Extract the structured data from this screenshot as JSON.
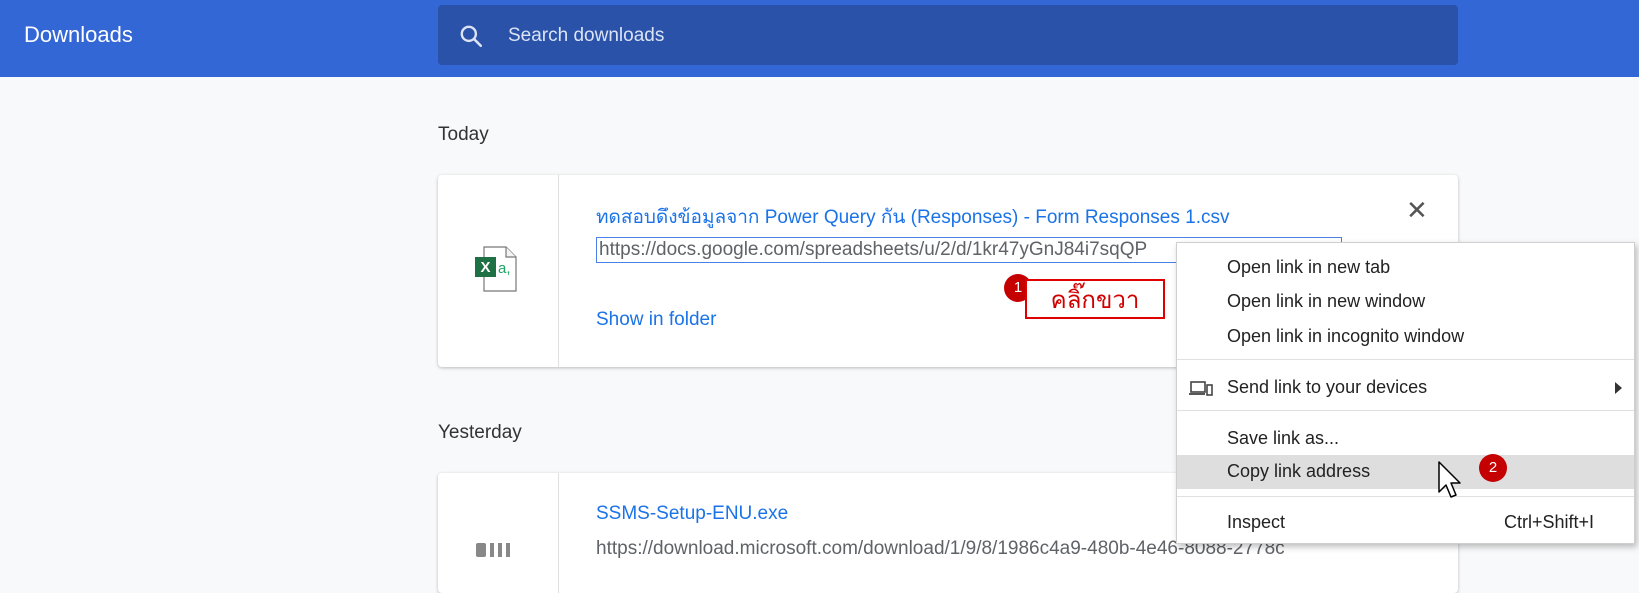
{
  "header": {
    "title": "Downloads",
    "search_placeholder": "Search downloads"
  },
  "sections": {
    "today": "Today",
    "yesterday": "Yesterday"
  },
  "downloads": [
    {
      "name": "ทดสอบดึงข้อมูลจาก Power Query กัน (Responses) - Form Responses 1.csv",
      "url": "https://docs.google.com/spreadsheets/u/2/d/1kr47yGnJ84i7sqQP",
      "action": "Show in folder",
      "icon": "excel-csv-icon"
    },
    {
      "name": "SSMS-Setup-ENU.exe",
      "url": "https://download.microsoft.com/download/1/9/8/1986c4a9-480b-4e46-8088-2778c",
      "icon": "installer-icon"
    }
  ],
  "annotations": {
    "step1_number": "1",
    "step1_text": "คลิ๊กขวา",
    "step2_number": "2",
    "color": "#c40000"
  },
  "context_menu": {
    "items": {
      "open_new_tab": "Open link in new tab",
      "open_new_window": "Open link in new window",
      "open_incognito": "Open link in incognito window",
      "send_to_devices": "Send link to your devices",
      "save_link_as": "Save link as...",
      "copy_link_address": "Copy link address",
      "inspect": "Inspect",
      "inspect_shortcut": "Ctrl+Shift+I"
    }
  },
  "colors": {
    "header_bg": "#3367d6",
    "search_bg": "#2a52a9",
    "link": "#1a73e8"
  }
}
